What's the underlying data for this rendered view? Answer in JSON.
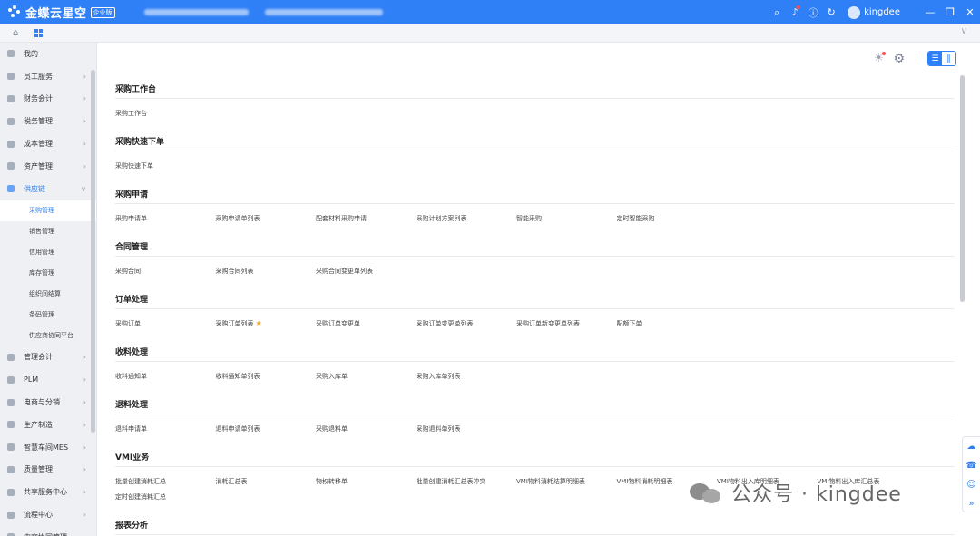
{
  "app": {
    "brand_name": "金蝶云星空",
    "brand_tag": "企业版",
    "username": "kingdee",
    "accent_color": "#2f7ff6"
  },
  "topbar_icons": [
    "search-icon",
    "bell-icon",
    "help-icon",
    "refresh-icon"
  ],
  "window_controls": [
    "minimize-icon",
    "restore-icon",
    "close-icon"
  ],
  "sidebar": {
    "items": [
      {
        "label": "我的",
        "icon": "grid-icon",
        "expanded": false,
        "has_chevron": false
      },
      {
        "label": "员工服务",
        "icon": "people-icon",
        "expanded": false,
        "has_chevron": true
      },
      {
        "label": "财务会计",
        "icon": "ledger-icon",
        "expanded": false,
        "has_chevron": true
      },
      {
        "label": "税务管理",
        "icon": "tax-icon",
        "expanded": false,
        "has_chevron": true
      },
      {
        "label": "成本管理",
        "icon": "cost-icon",
        "expanded": false,
        "has_chevron": true
      },
      {
        "label": "资产管理",
        "icon": "asset-icon",
        "expanded": false,
        "has_chevron": true
      },
      {
        "label": "供应链",
        "icon": "supply-chain-icon",
        "expanded": true,
        "has_chevron": true
      }
    ],
    "subitems": [
      {
        "label": "采购管理",
        "selected": true
      },
      {
        "label": "销售管理",
        "selected": false
      },
      {
        "label": "信用管理",
        "selected": false
      },
      {
        "label": "库存管理",
        "selected": false
      },
      {
        "label": "组织间结算",
        "selected": false
      },
      {
        "label": "条码管理",
        "selected": false
      },
      {
        "label": "供应商协同平台",
        "selected": false
      }
    ],
    "items_after": [
      {
        "label": "管理会计",
        "icon": "management-icon"
      },
      {
        "label": "PLM",
        "icon": "plm-icon"
      },
      {
        "label": "电商与分销",
        "icon": "ecommerce-icon"
      },
      {
        "label": "生产制造",
        "icon": "factory-icon"
      },
      {
        "label": "智慧车间MES",
        "icon": "mes-icon"
      },
      {
        "label": "质量管理",
        "icon": "quality-icon"
      },
      {
        "label": "共享服务中心",
        "icon": "shared-service-icon"
      },
      {
        "label": "流程中心",
        "icon": "process-icon"
      },
      {
        "label": "内容协同管理",
        "icon": "content-icon"
      }
    ]
  },
  "groups": [
    {
      "title": "采购工作台",
      "links": [
        "采购工作台"
      ]
    },
    {
      "title": "采购快速下单",
      "links": [
        "采购快速下单"
      ]
    },
    {
      "title": "采购申请",
      "links": [
        "采购申请单",
        "采购申请单列表",
        "配套材料采购申请",
        "采购计划方案列表",
        "智能采购",
        "定时智能采购"
      ]
    },
    {
      "title": "合同管理",
      "links": [
        "采购合同",
        "采购合同列表",
        "采购合同变更单列表"
      ]
    },
    {
      "title": "订单处理",
      "links": [
        "采购订单",
        "采购订单列表",
        "采购订单变更单",
        "采购订单变更单列表",
        "采购订单新变更单列表",
        "配额下单"
      ],
      "starred_index": 1
    },
    {
      "title": "收料处理",
      "links": [
        "收料通知单",
        "收料通知单列表",
        "采购入库单",
        "采购入库单列表"
      ]
    },
    {
      "title": "退料处理",
      "links": [
        "退料申请单",
        "退料申请单列表",
        "采购退料单",
        "采购退料单列表"
      ]
    },
    {
      "title": "VMI业务",
      "links": [
        "批量创建消耗汇总",
        "消耗汇总表",
        "物权转移单",
        "批量创建消耗汇总表冲突",
        "VMI物料消耗结算明细表",
        "VMI物料消耗明细表",
        "VMI物料出入库明细表",
        "VMI物料出入库汇总表",
        "定时创建消耗汇总"
      ]
    },
    {
      "title": "报表分析",
      "links": []
    }
  ],
  "float_bar": [
    "cloud-icon",
    "headset-icon",
    "smile-icon",
    "expand-icon"
  ],
  "watermark": {
    "text": "公众号 · kingdee"
  }
}
